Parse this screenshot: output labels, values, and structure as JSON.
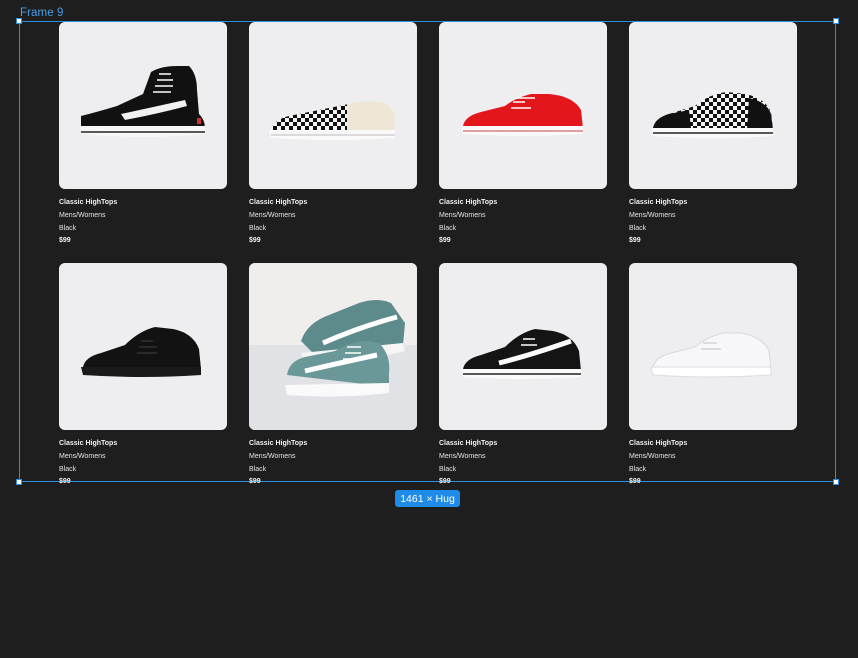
{
  "canvas": {
    "frame_label": "Frame 9",
    "size_badge": "1461 × Hug"
  },
  "products": [
    {
      "title": "Classic HighTops",
      "audience": "Mens/Womens",
      "color": "Black",
      "price": "$99",
      "image_icon": "black-hightop-sneaker"
    },
    {
      "title": "Classic HighTops",
      "audience": "Mens/Womens",
      "color": "Black",
      "price": "$99",
      "image_icon": "checkerboard-slipon-sneaker"
    },
    {
      "title": "Classic HighTops",
      "audience": "Mens/Womens",
      "color": "Black",
      "price": "$99",
      "image_icon": "red-lowtop-sneaker"
    },
    {
      "title": "Classic HighTops",
      "audience": "Mens/Womens",
      "color": "Black",
      "price": "$99",
      "image_icon": "checkerboard-lowtop-sneaker"
    },
    {
      "title": "Classic HighTops",
      "audience": "Mens/Womens",
      "color": "Black",
      "price": "$99",
      "image_icon": "all-black-lowtop-sneaker"
    },
    {
      "title": "Classic HighTops",
      "audience": "Mens/Womens",
      "color": "Black",
      "price": "$99",
      "image_icon": "teal-sneaker-pair"
    },
    {
      "title": "Classic HighTops",
      "audience": "Mens/Womens",
      "color": "Black",
      "price": "$99",
      "image_icon": "black-white-lowtop-sneaker"
    },
    {
      "title": "Classic HighTops",
      "audience": "Mens/Womens",
      "color": "Black",
      "price": "$99",
      "image_icon": "white-lowtop-sneaker"
    }
  ],
  "colors": {
    "canvas_bg": "#1e1e1e",
    "selection": "#2c8fe6",
    "card_bg": "#eeedf0"
  }
}
